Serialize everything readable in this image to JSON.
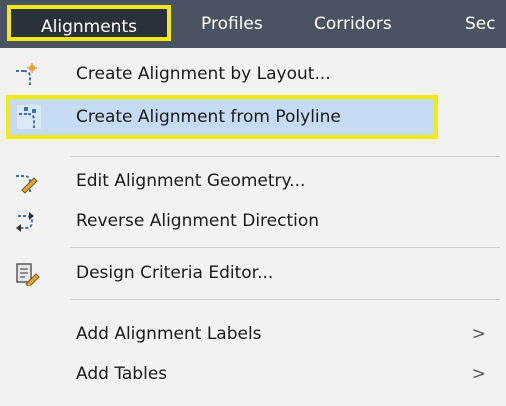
{
  "menubar": {
    "items": [
      {
        "label": "Alignments",
        "active": true
      },
      {
        "label": "Profiles"
      },
      {
        "label": "Corridors"
      },
      {
        "label": "Sec"
      }
    ]
  },
  "dropdown": {
    "items": [
      {
        "label": "Create Alignment by Layout...",
        "icon": "alignment-layout-icon"
      },
      {
        "label": "Create Alignment from Polyline",
        "icon": "alignment-polyline-icon",
        "highlighted": true
      },
      {
        "label": "Edit Alignment Geometry...",
        "icon": "edit-geometry-icon"
      },
      {
        "label": "Reverse Alignment Direction",
        "icon": "reverse-direction-icon"
      },
      {
        "label": "Design Criteria Editor...",
        "icon": "design-criteria-icon"
      },
      {
        "label": "Add Alignment Labels",
        "submenu": true
      },
      {
        "label": "Add Tables",
        "submenu": true
      }
    ],
    "submenu_arrow": ">"
  },
  "colors": {
    "menubar_bg": "#4a5361",
    "active_bg": "#2b313b",
    "highlight_border": "#f2ea12",
    "highlight_bg": "#c5dbf3",
    "dropdown_bg": "#f2f2f2",
    "icon_orange": "#e8a23a",
    "icon_blue": "#3b6fb6"
  }
}
